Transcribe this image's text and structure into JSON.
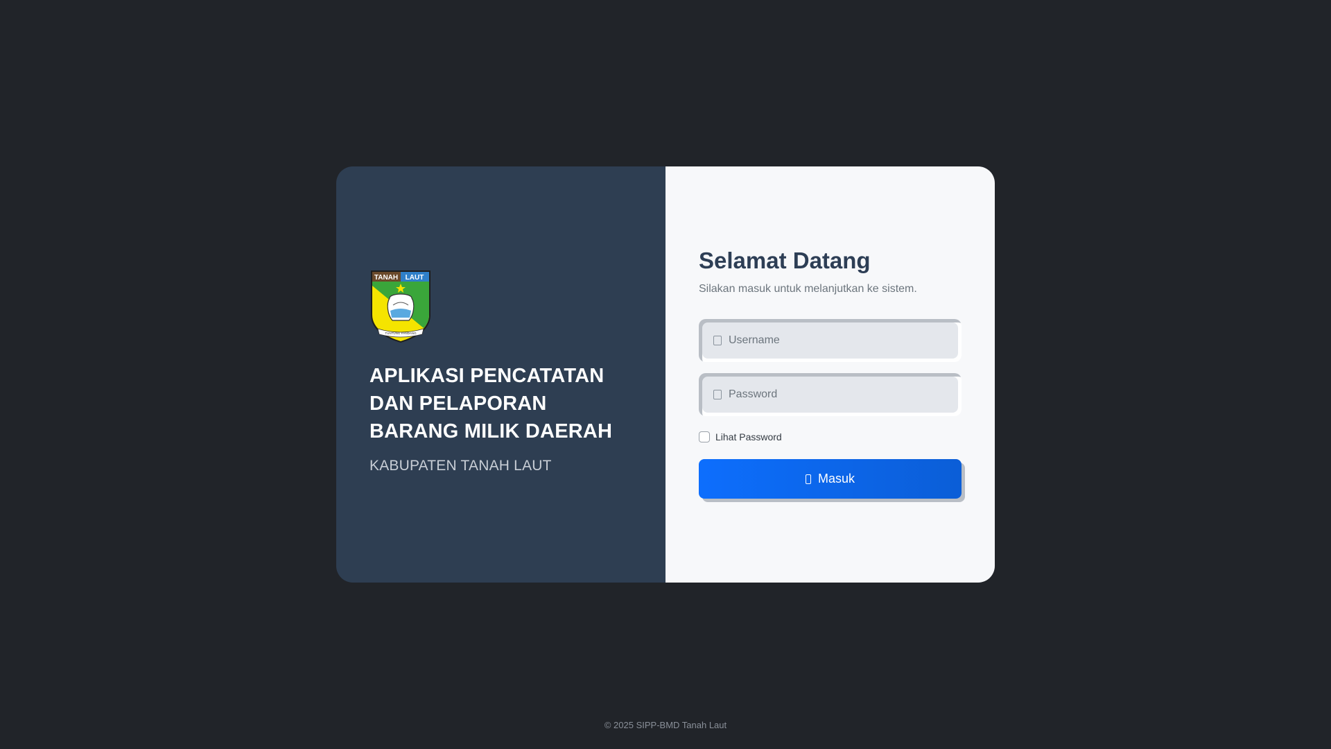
{
  "app": {
    "title": "APLIKASI PENCATATAN DAN PELAPORAN BARANG MILIK DAERAH",
    "subtitle": "KABUPATEN TANAH LAUT",
    "logo": {
      "label_left": "TANAH",
      "label_right": "LAUT",
      "ribbon_text": "TUNTUNG PANDANG",
      "icon": "tanah-laut-coat-of-arms"
    }
  },
  "login": {
    "heading": "Selamat Datang",
    "subheading": "Silakan masuk untuk melanjutkan ke sistem.",
    "username": {
      "placeholder": "Username",
      "value": "",
      "icon": "user-icon"
    },
    "password": {
      "placeholder": "Password",
      "value": "",
      "icon": "lock-icon"
    },
    "show_password_label": "Lihat Password",
    "show_password_checked": false,
    "submit_label": "Masuk",
    "submit_icon": "login-icon"
  },
  "footer": {
    "text": "© 2025 SIPP-BMD Tanah Laut"
  },
  "colors": {
    "background": "#212429",
    "panel_left": "#2e3e52",
    "panel_right": "#f7f8fa",
    "primary": "#0d6efd",
    "heading": "#2d3e55"
  }
}
